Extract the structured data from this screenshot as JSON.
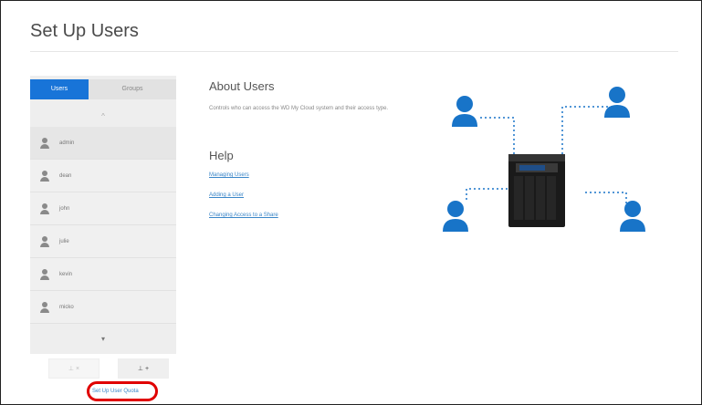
{
  "page": {
    "title": "Set Up Users"
  },
  "tabs": {
    "users_label": "Users",
    "groups_label": "Groups"
  },
  "user_list": {
    "scroll_up": "^",
    "scroll_down": "▾",
    "users": [
      {
        "name": "admin"
      },
      {
        "name": "dean"
      },
      {
        "name": "john"
      },
      {
        "name": "julie"
      },
      {
        "name": "kevin"
      },
      {
        "name": "micko"
      }
    ]
  },
  "buttons": {
    "remove_label": "⊥ ×",
    "add_label": "⊥ +"
  },
  "footer": {
    "view_link": "Set Up User Quota"
  },
  "about": {
    "title": "About Users",
    "description": "Controls who can access the WD My Cloud system and their access type."
  },
  "help": {
    "title": "Help",
    "links": [
      "Managing Users",
      "Adding a User",
      "Changing Access to a Share"
    ]
  },
  "colors": {
    "accent": "#1874d8",
    "user_icon": "#1874c8",
    "highlight": "#e00000"
  },
  "icons": {
    "user": "user-icon",
    "nas": "nas-device-icon"
  }
}
